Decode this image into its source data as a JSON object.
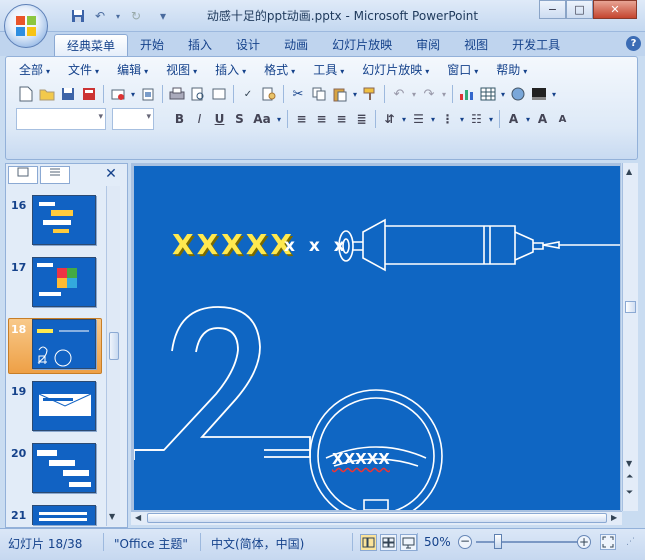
{
  "window": {
    "title": "动感十足的ppt动画.pptx - Microsoft PowerPoint",
    "minimize": "−",
    "maximize": "□",
    "close": "✕"
  },
  "quick_access": {
    "dropdown": "▾"
  },
  "ribbon_tabs": [
    "经典菜单",
    "开始",
    "插入",
    "设计",
    "动画",
    "幻灯片放映",
    "审阅",
    "视图",
    "开发工具"
  ],
  "help": "?",
  "classic_menu": [
    "全部",
    "文件",
    "编辑",
    "视图",
    "插入",
    "格式",
    "工具",
    "幻灯片放映",
    "窗口",
    "帮助"
  ],
  "slide_pane": {
    "thumbnails": [
      {
        "number": "16"
      },
      {
        "number": "17"
      },
      {
        "number": "18",
        "selected": true
      },
      {
        "number": "19"
      },
      {
        "number": "20"
      },
      {
        "number": "21"
      }
    ]
  },
  "slide": {
    "heading": "XXXXX",
    "syringe_label": "x x x",
    "big_number": "2",
    "wheel_label": "XXXXX",
    "background": "#0f66c3",
    "heading_color": "#ffe94f"
  },
  "status": {
    "slide_info": "幻灯片 18/38",
    "theme": "\"Office 主题\"",
    "language": "中文(简体，中国)",
    "zoom": "50%"
  }
}
